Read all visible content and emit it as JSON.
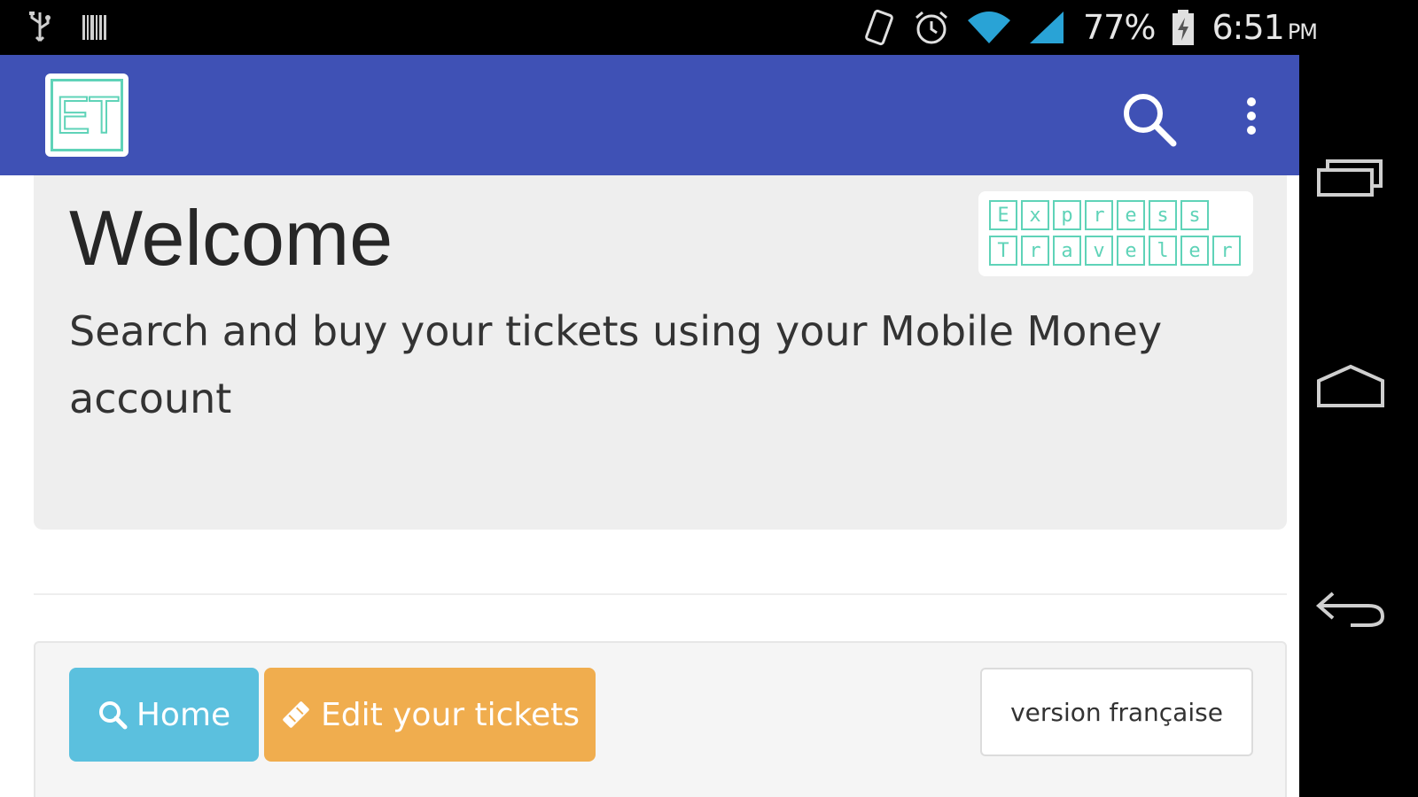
{
  "status_bar": {
    "battery": "77%",
    "time": "6:51",
    "ampm": "PM",
    "icons": [
      "usb-icon",
      "barcode-icon",
      "rotate-icon",
      "alarm-icon",
      "wifi-icon",
      "signal-icon",
      "battery-icon"
    ]
  },
  "app_bar": {
    "logo_text": "ET",
    "actions": [
      "search-icon",
      "more-vert-icon"
    ],
    "color": "#3f51b5"
  },
  "jumbotron": {
    "title": "Welcome",
    "tagline": "Search and buy your tickets using your Mobile Money account",
    "brand_row1": [
      "E",
      "x",
      "p",
      "r",
      "e",
      "s",
      "s"
    ],
    "brand_row2": [
      "T",
      "r",
      "a",
      "v",
      "e",
      "l",
      "e",
      "r"
    ]
  },
  "footer": {
    "home_label": "Home",
    "edit_label": "Edit your tickets",
    "lang_label": "version française"
  },
  "nav_bar": {
    "icons": [
      "recent-apps-icon",
      "home-icon",
      "back-icon"
    ]
  },
  "colors": {
    "accent": "#3f51b5",
    "info": "#5bc0de",
    "warning": "#f0ad4e",
    "brand_teal": "#5fd3b8"
  }
}
